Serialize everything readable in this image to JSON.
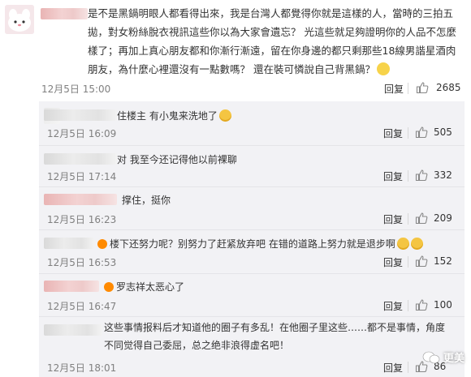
{
  "main_comment": {
    "text": "是不是黑鍋明眼人都看得出來，我是台灣人都覺得你就是這樣的人，當時的三拍五拋，對女粉絲脫衣視訊這些你以為大家會遺忘？ 光這些就足夠證明你的人品不怎麼樣了；再加上真心朋友都和你漸行漸遠，留在你身邊的都只剩那些18線男諧星酒肉朋友，為什麼心裡還沒有一點數嗎？ 還在裝可憐說自己背黑鍋？",
    "time": "12月5日 15:00",
    "reply_label": "回复",
    "likes": "2685"
  },
  "replies": [
    {
      "text": "住楼主 有小鬼来洗地了",
      "time": "12月5日 16:09",
      "reply_label": "回复",
      "likes": "505"
    },
    {
      "text": "对 我至今还记得他以前裸聊",
      "time": "12月5日 17:14",
      "reply_label": "回复",
      "likes": "332"
    },
    {
      "text": "撑住，挺你",
      "time": "12月5日 16:23",
      "reply_label": "回复",
      "likes": "209"
    },
    {
      "text": "楼下还努力呢？别努力了赶紧放弃吧 在错的道路上努力就是退步啊",
      "time": "12月5日 16:53",
      "reply_label": "回复",
      "likes": "152"
    },
    {
      "text": "罗志祥太恶心了",
      "time": "12月5日 16:47",
      "reply_label": "回复",
      "likes": "100"
    },
    {
      "text": "这些事情报料后才知道他的圈子有多乱！在他圈子里这些……都不是事情，角度不同觉得自己委屈，总之绝非浪得虚名吧！",
      "time": "12月5日 18:01",
      "reply_label": "回复",
      "likes": "86"
    }
  ],
  "watermark": {
    "label": "更美"
  },
  "colors": {
    "reply_bg": "#f2f2f5",
    "muted_text": "#808080",
    "name_blur_pink": "#eecaca"
  }
}
